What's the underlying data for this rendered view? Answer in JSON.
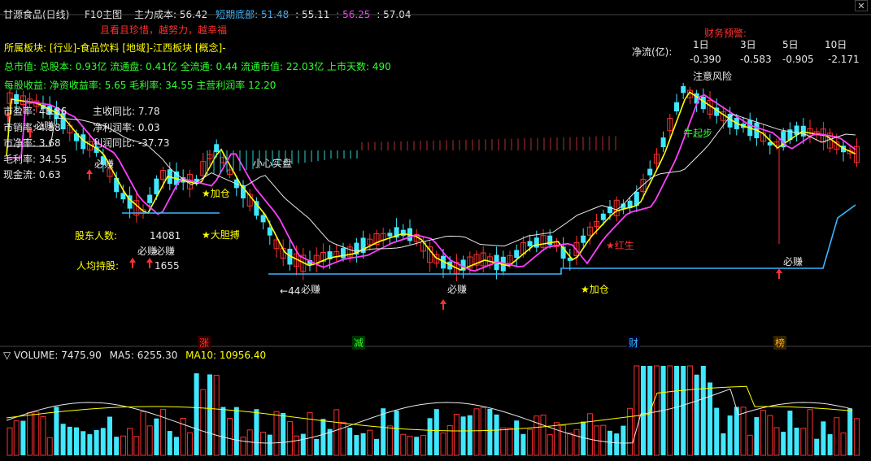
{
  "title_bar": {
    "stock": "甘源食品(日线)",
    "f10": "F10主图"
  },
  "indicator_row": {
    "main_cost_label": "主力成本:",
    "main_cost": "56.42",
    "short_bottom_label": "短期底部:",
    "short_bottom": "51.48",
    "v2": "55.11",
    "v3": "56.25",
    "v4": "57.04"
  },
  "slogan": "且看且珍惜，越努力，越幸福",
  "info": {
    "sector": "所属板块: [行业]-食品饮料 [地域]-江西板块 [概念]-",
    "capital": "总市值: 总股本: 0.93亿 流通盘: 0.41亿 全流通: 0.44 流通市值: 22.03亿 上市天数: 490",
    "fin": "每股收益: 净资收益率: 5.65 毛利率: 34.55 主营利润率 12.20"
  },
  "left_stats": [
    {
      "label": "市盈率:",
      "value": "48.86"
    },
    {
      "label": "市销率:",
      "value": "4.58"
    },
    {
      "label": "市净率:",
      "value": "3.68"
    },
    {
      "label": "毛利率:",
      "value": "34.55"
    },
    {
      "label": "现金流:",
      "value": "0.63"
    }
  ],
  "mid_stats": [
    {
      "label": "主收同比:",
      "value": "7.78"
    },
    {
      "label": "净利润率:",
      "value": "0.03"
    },
    {
      "label": "利润同比:",
      "value": "-37.73"
    }
  ],
  "holders": {
    "count_label": "股东人数:",
    "count": "14081",
    "avg_label": "人均持股:",
    "avg": "1655"
  },
  "warning": {
    "title": "财务预警:",
    "note": "注意风险"
  },
  "netflow": {
    "label": "净流(亿):",
    "headers": [
      "1日",
      "3日",
      "5日",
      "10日"
    ],
    "values": [
      "-0.390",
      "-0.583",
      "-0.905",
      "-2.171"
    ]
  },
  "annotations": {
    "bizhuan": "必赚",
    "jiacang": "加仓",
    "dadanbo": "大胆搏",
    "xiaoxin": "小心实盘",
    "hongsheng": "红生",
    "niuqibu": "牛起步",
    "low_price": "44"
  },
  "news_marks": [
    "涨",
    "减",
    "财",
    "榜"
  ],
  "volume": {
    "label": "VOLUME:",
    "value": "7475.90",
    "ma5_label": "MA5:",
    "ma5": "6255.30",
    "ma10_label": "MA10:",
    "ma10": "10956.40"
  },
  "colors": {
    "up": "#ff3030",
    "down": "#40e8ff",
    "ma_short": "#ffff00",
    "ma_mid": "#ff40ff",
    "ma_long": "#e8e8e8",
    "support": "#38b8ff"
  }
}
